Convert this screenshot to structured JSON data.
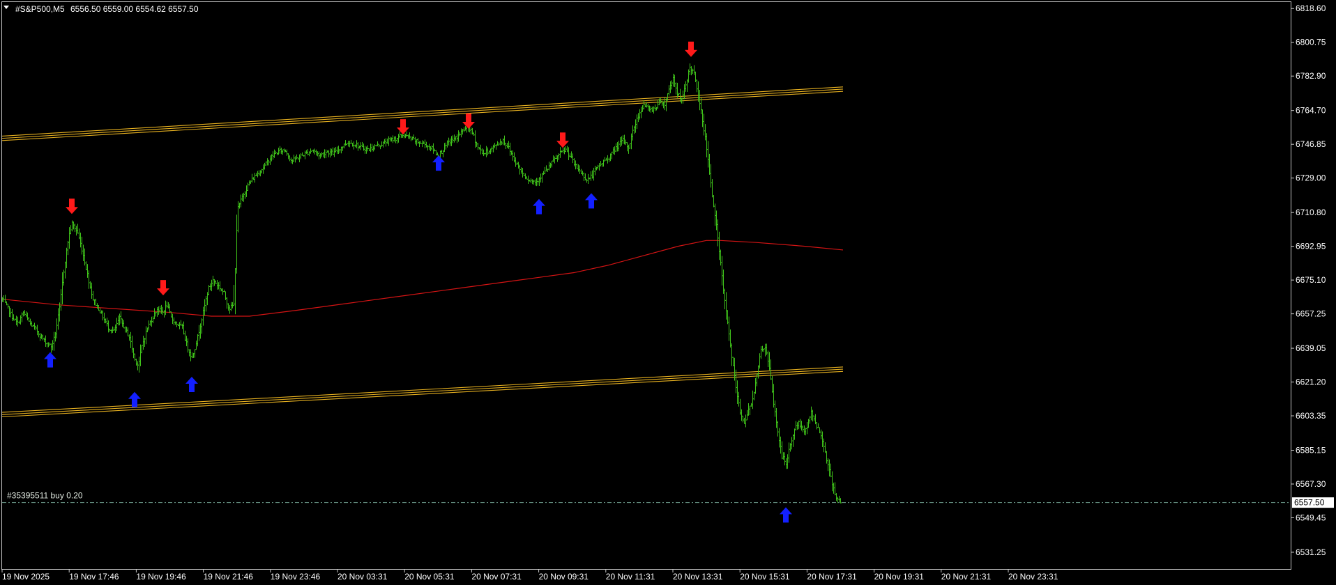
{
  "header": {
    "symbol": "#S&P500,M5",
    "ohlc": "6556.50 6559.00 6554.62 6557.50"
  },
  "order": {
    "label": "#35395511 buy 0.20",
    "price": 6557.5
  },
  "price_tag": "6557.50",
  "colors": {
    "background": "#000000",
    "bars": "#3fc21a",
    "moving_average": "#d41414",
    "channel": "#e6b020",
    "up_arrow": "#1320ff",
    "down_arrow": "#ff1a1a",
    "grid_frame": "#c8c8c8",
    "order_line": "#6f9f8f"
  },
  "chart_data": {
    "type": "bar",
    "timeframe": "M5",
    "ylim": [
      6522.4,
      6822.0
    ],
    "y_ticks": [
      "6818.60",
      "6800.75",
      "6782.90",
      "6764.70",
      "6746.85",
      "6729.00",
      "6710.80",
      "6692.95",
      "6675.10",
      "6657.25",
      "6639.05",
      "6621.20",
      "6603.35",
      "6585.15",
      "6567.30",
      "6549.45",
      "6531.25"
    ],
    "x_ticks": [
      "19 Nov 2025",
      "19 Nov 17:46",
      "19 Nov 19:46",
      "19 Nov 21:46",
      "19 Nov 23:46",
      "20 Nov 03:31",
      "20 Nov 05:31",
      "20 Nov 07:31",
      "20 Nov 09:31",
      "20 Nov 11:31",
      "20 Nov 13:31",
      "20 Nov 15:31",
      "20 Nov 17:31",
      "20 Nov 19:31",
      "20 Nov 21:31",
      "20 Nov 23:31"
    ],
    "close_path": [
      [
        0,
        6665
      ],
      [
        8,
        6660
      ],
      [
        15,
        6655
      ],
      [
        22,
        6652
      ],
      [
        30,
        6658
      ],
      [
        40,
        6652
      ],
      [
        50,
        6648
      ],
      [
        60,
        6643
      ],
      [
        70,
        6640
      ],
      [
        75,
        6645
      ],
      [
        82,
        6660
      ],
      [
        88,
        6680
      ],
      [
        95,
        6698
      ],
      [
        100,
        6705
      ],
      [
        108,
        6700
      ],
      [
        115,
        6690
      ],
      [
        122,
        6678
      ],
      [
        130,
        6665
      ],
      [
        138,
        6660
      ],
      [
        145,
        6655
      ],
      [
        152,
        6650
      ],
      [
        160,
        6648
      ],
      [
        168,
        6655
      ],
      [
        175,
        6650
      ],
      [
        182,
        6645
      ],
      [
        190,
        6633
      ],
      [
        195,
        6630
      ],
      [
        200,
        6640
      ],
      [
        208,
        6650
      ],
      [
        215,
        6655
      ],
      [
        222,
        6660
      ],
      [
        230,
        6658
      ],
      [
        236,
        6662
      ],
      [
        242,
        6655
      ],
      [
        250,
        6652
      ],
      [
        258,
        6650
      ],
      [
        265,
        6640
      ],
      [
        272,
        6634
      ],
      [
        280,
        6645
      ],
      [
        288,
        6658
      ],
      [
        295,
        6670
      ],
      [
        302,
        6675
      ],
      [
        310,
        6672
      ],
      [
        318,
        6668
      ],
      [
        325,
        6660
      ],
      [
        332,
        6662
      ],
      [
        337,
        6712
      ],
      [
        345,
        6720
      ],
      [
        355,
        6727
      ],
      [
        365,
        6731
      ],
      [
        375,
        6735
      ],
      [
        385,
        6740
      ],
      [
        395,
        6743
      ],
      [
        405,
        6744
      ],
      [
        415,
        6738
      ],
      [
        425,
        6740
      ],
      [
        435,
        6742
      ],
      [
        445,
        6744
      ],
      [
        455,
        6741
      ],
      [
        465,
        6743
      ],
      [
        475,
        6742
      ],
      [
        485,
        6745
      ],
      [
        495,
        6748
      ],
      [
        505,
        6747
      ],
      [
        515,
        6745
      ],
      [
        525,
        6744
      ],
      [
        535,
        6746
      ],
      [
        545,
        6747
      ],
      [
        555,
        6749
      ],
      [
        565,
        6750
      ],
      [
        575,
        6752
      ],
      [
        585,
        6750
      ],
      [
        595,
        6748
      ],
      [
        605,
        6747
      ],
      [
        615,
        6745
      ],
      [
        625,
        6741
      ],
      [
        630,
        6743
      ],
      [
        640,
        6748
      ],
      [
        650,
        6750
      ],
      [
        660,
        6754
      ],
      [
        668,
        6756
      ],
      [
        675,
        6752
      ],
      [
        682,
        6745
      ],
      [
        690,
        6742
      ],
      [
        700,
        6744
      ],
      [
        710,
        6747
      ],
      [
        718,
        6749
      ],
      [
        726,
        6745
      ],
      [
        735,
        6738
      ],
      [
        745,
        6732
      ],
      [
        755,
        6728
      ],
      [
        765,
        6727
      ],
      [
        770,
        6729
      ],
      [
        780,
        6733
      ],
      [
        790,
        6738
      ],
      [
        800,
        6742
      ],
      [
        808,
        6744
      ],
      [
        815,
        6740
      ],
      [
        822,
        6735
      ],
      [
        830,
        6732
      ],
      [
        838,
        6728
      ],
      [
        845,
        6730
      ],
      [
        852,
        6734
      ],
      [
        860,
        6737
      ],
      [
        870,
        6740
      ],
      [
        880,
        6745
      ],
      [
        890,
        6749
      ],
      [
        898,
        6745
      ],
      [
        905,
        6755
      ],
      [
        912,
        6762
      ],
      [
        920,
        6768
      ],
      [
        928,
        6765
      ],
      [
        936,
        6766
      ],
      [
        944,
        6770
      ],
      [
        950,
        6768
      ],
      [
        956,
        6776
      ],
      [
        962,
        6782
      ],
      [
        968,
        6774
      ],
      [
        974,
        6770
      ],
      [
        980,
        6778
      ],
      [
        986,
        6788
      ],
      [
        992,
        6784
      ],
      [
        998,
        6772
      ],
      [
        1004,
        6760
      ],
      [
        1010,
        6745
      ],
      [
        1015,
        6728
      ],
      [
        1022,
        6710
      ],
      [
        1028,
        6690
      ],
      [
        1034,
        6670
      ],
      [
        1040,
        6652
      ],
      [
        1046,
        6635
      ],
      [
        1052,
        6618
      ],
      [
        1058,
        6605
      ],
      [
        1064,
        6600
      ],
      [
        1070,
        6606
      ],
      [
        1076,
        6612
      ],
      [
        1082,
        6626
      ],
      [
        1088,
        6638
      ],
      [
        1094,
        6640
      ],
      [
        1100,
        6628
      ],
      [
        1106,
        6610
      ],
      [
        1112,
        6595
      ],
      [
        1118,
        6582
      ],
      [
        1124,
        6578
      ],
      [
        1130,
        6588
      ],
      [
        1136,
        6596
      ],
      [
        1142,
        6600
      ],
      [
        1148,
        6595
      ],
      [
        1154,
        6598
      ],
      [
        1160,
        6605
      ],
      [
        1166,
        6600
      ],
      [
        1172,
        6595
      ],
      [
        1178,
        6588
      ],
      [
        1184,
        6577
      ],
      [
        1190,
        6568
      ],
      [
        1196,
        6560
      ],
      [
        1203,
        6557.5
      ]
    ],
    "moving_average": [
      [
        0,
        6665
      ],
      [
        80,
        6662
      ],
      [
        160,
        6660
      ],
      [
        240,
        6658
      ],
      [
        300,
        6656
      ],
      [
        355,
        6656
      ],
      [
        420,
        6659
      ],
      [
        500,
        6663
      ],
      [
        580,
        6667
      ],
      [
        660,
        6671
      ],
      [
        740,
        6675
      ],
      [
        820,
        6679
      ],
      [
        870,
        6683
      ],
      [
        920,
        6688
      ],
      [
        970,
        6693
      ],
      [
        1010,
        6696
      ],
      [
        1030,
        6696
      ],
      [
        1080,
        6695
      ],
      [
        1150,
        6693
      ],
      [
        1206,
        6691
      ]
    ],
    "channel_upper": [
      [
        0,
        6750
      ],
      [
        1206,
        6776
      ]
    ],
    "channel_lower": [
      [
        0,
        6604
      ],
      [
        1206,
        6628
      ]
    ],
    "buy_arrows": [
      [
        69,
        6637
      ],
      [
        190,
        6616
      ],
      [
        272,
        6624
      ],
      [
        626,
        6741
      ],
      [
        770,
        6718
      ],
      [
        845,
        6721
      ],
      [
        1124,
        6555
      ]
    ],
    "sell_arrows": [
      [
        100,
        6710
      ],
      [
        231,
        6667
      ],
      [
        575,
        6752
      ],
      [
        669,
        6755
      ],
      [
        804,
        6745
      ],
      [
        988,
        6793
      ]
    ],
    "order_price": 6557.5
  }
}
